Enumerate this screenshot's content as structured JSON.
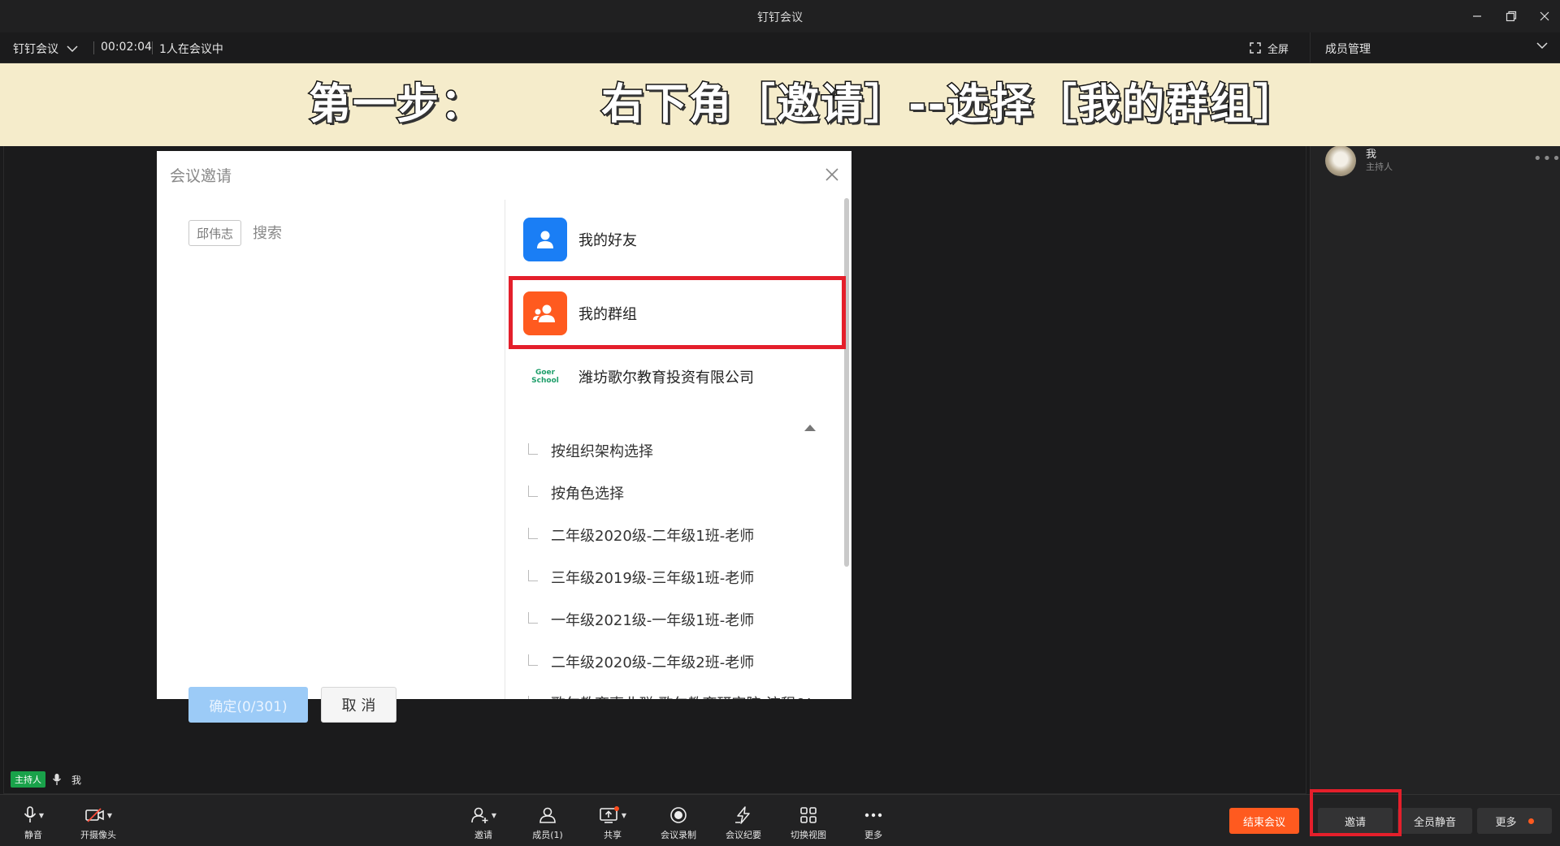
{
  "window": {
    "title": "钉钉会议"
  },
  "info_bar": {
    "meeting_name": "钉钉会议",
    "duration": "00:02:04",
    "participants": "1人在会议中",
    "fullscreen_label": "全屏",
    "members_header": "成员管理"
  },
  "banner": {
    "step": "第一步：",
    "instruction": "右下角［邀请］--选择［我的群组］"
  },
  "dialog": {
    "title": "会议邀请",
    "selected_chip": "邱伟志",
    "search_placeholder": "搜索",
    "confirm_label": "确定(0/301)",
    "cancel_label": "取 消",
    "friends_label": "我的好友",
    "groups_label": "我的群组",
    "org_logo_text": "Goer School",
    "org_name": "潍坊歌尔教育投资有限公司",
    "sub_items": [
      "按组织架构选择",
      "按角色选择",
      "二年级2020级-二年级1班-老师",
      "三年级2019级-三年级1班-老师",
      "一年级2021级-一年级1班-老师",
      "二年级2020级-二年级2班-老师",
      "歌尔教育事业群-歌尔教育研究院-流程&I"
    ]
  },
  "member_panel": {
    "member_name": "我",
    "member_role": "主持人"
  },
  "stage": {
    "host_badge": "主持人",
    "self_label": "我"
  },
  "toolbar": {
    "mute": "静音",
    "camera": "开摄像头",
    "invite": "邀请",
    "members": "成员(1)",
    "share": "共享",
    "record": "会议录制",
    "minutes": "会议纪要",
    "switch_view": "切换视图",
    "more": "更多",
    "end_meeting": "结束会议",
    "invite_btn": "邀请",
    "mute_all": "全员静音",
    "more_btn": "更多"
  },
  "colors": {
    "end_button": "#ff5a1f",
    "highlight_box": "#e41f2b",
    "host_badge": "#19a24a",
    "friends_icon": "#1a7ef5",
    "groups_icon": "#ff5a1f",
    "confirm_disabled": "#9ccbf7",
    "banner_bg": "#f5eccb"
  },
  "icons": [
    "minimize-icon",
    "restore-icon",
    "close-icon",
    "chevron-down-icon",
    "fullscreen-icon",
    "mic-icon",
    "camera-off-icon",
    "add-user-icon",
    "users-icon",
    "share-screen-icon",
    "record-icon",
    "lightning-icon",
    "grid-icon",
    "dots-icon",
    "person-icon",
    "group-icon",
    "triangle-up-icon"
  ]
}
